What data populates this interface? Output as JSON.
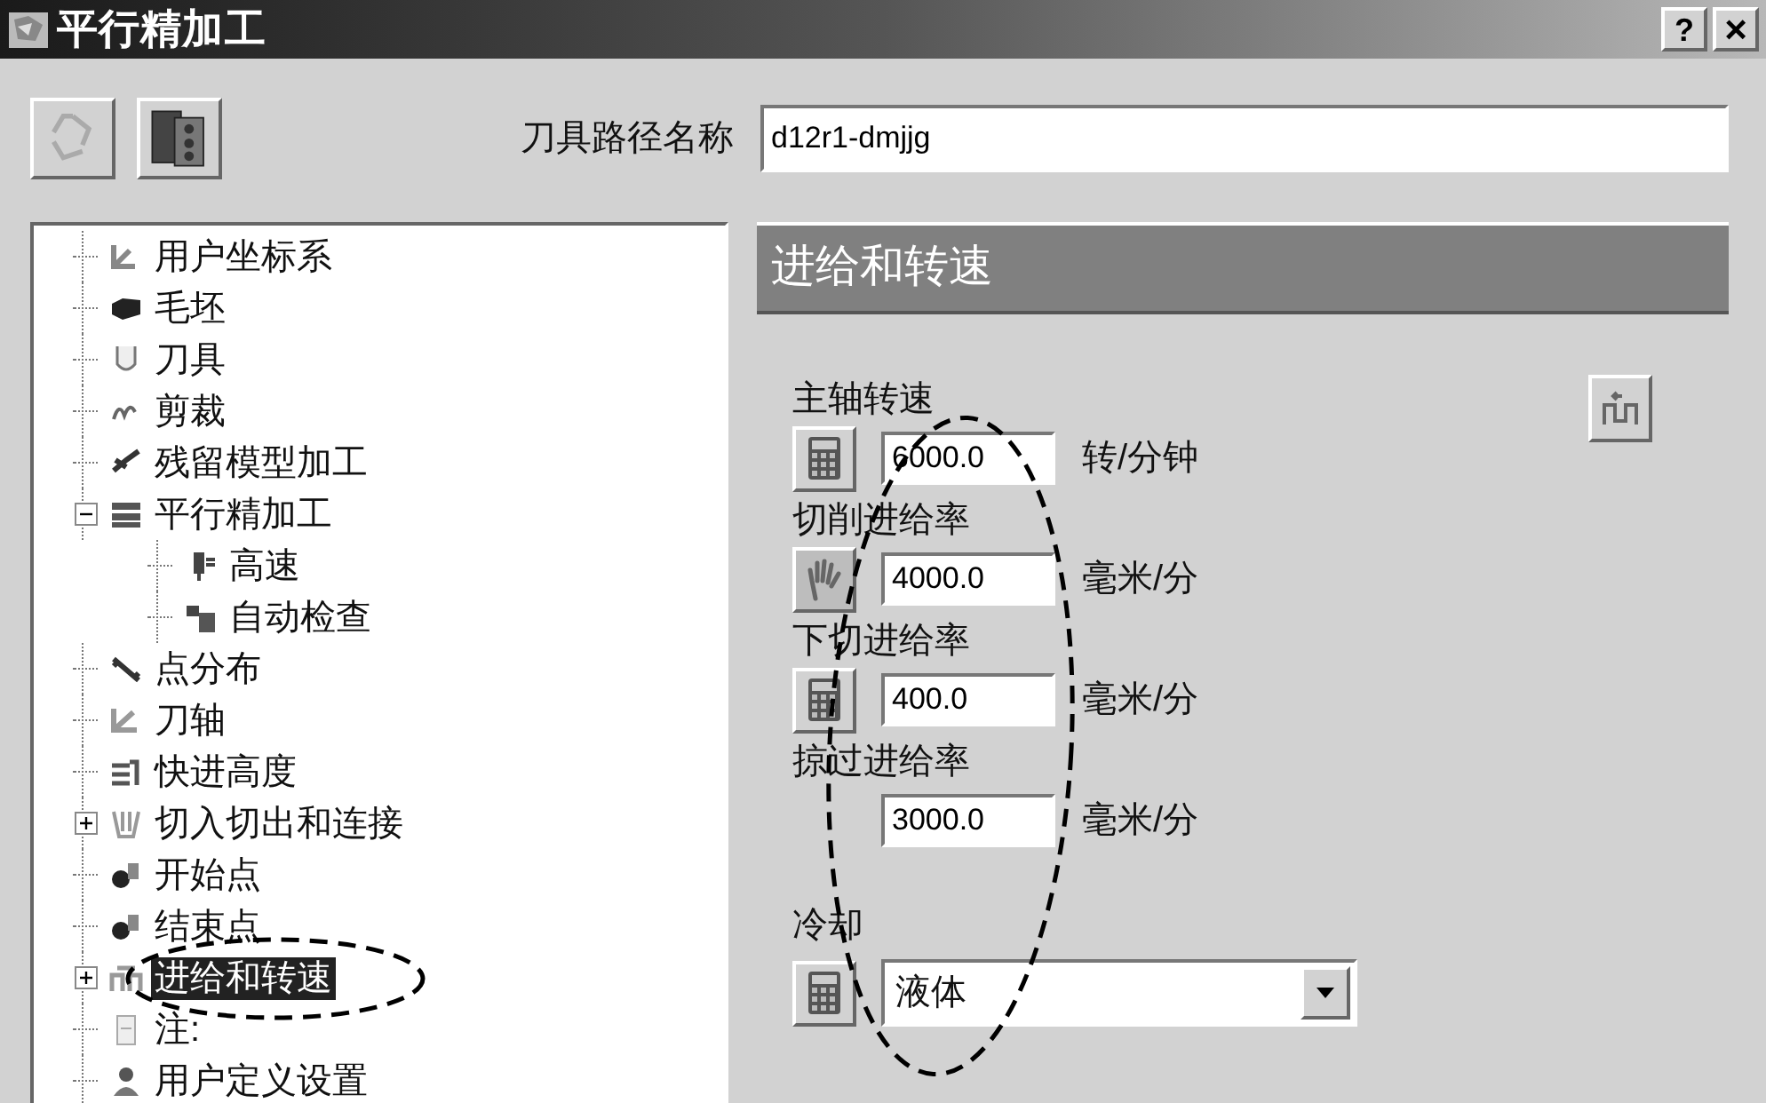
{
  "window": {
    "title": "平行精加工",
    "help_button": "?",
    "close_button": "×"
  },
  "toolpath_name": {
    "label": "刀具路径名称",
    "value": "d12r1-dmjjg"
  },
  "tree": [
    {
      "label": "用户坐标系"
    },
    {
      "label": "毛坯"
    },
    {
      "label": "刀具"
    },
    {
      "label": "剪裁"
    },
    {
      "label": "残留模型加工"
    },
    {
      "label": "平行精加工",
      "expanded": true,
      "children": [
        {
          "label": "高速"
        },
        {
          "label": "自动检查"
        }
      ]
    },
    {
      "label": "点分布"
    },
    {
      "label": "刀轴"
    },
    {
      "label": "快进高度"
    },
    {
      "label": "切入切出和连接",
      "expanded": false
    },
    {
      "label": "开始点"
    },
    {
      "label": "结束点"
    },
    {
      "label": "进给和转速",
      "expanded": false,
      "selected": true
    },
    {
      "label": "注:"
    },
    {
      "label": "用户定义设置"
    }
  ],
  "panel": {
    "title": "进给和转速",
    "fields": [
      {
        "label": "主轴转速",
        "kind": "calculator",
        "value": "6000.0",
        "unit": "转/分钟"
      },
      {
        "label": "切削进给率",
        "kind": "hand",
        "value": "4000.0",
        "unit": "毫米/分"
      },
      {
        "label": "下切进给率",
        "kind": "calculator",
        "value": "400.0",
        "unit": "毫米/分"
      },
      {
        "label": "掠过进给率",
        "kind": "plain",
        "value": "3000.0",
        "unit": "毫米/分"
      }
    ],
    "coolant": {
      "label": "冷却",
      "value": "液体"
    }
  }
}
